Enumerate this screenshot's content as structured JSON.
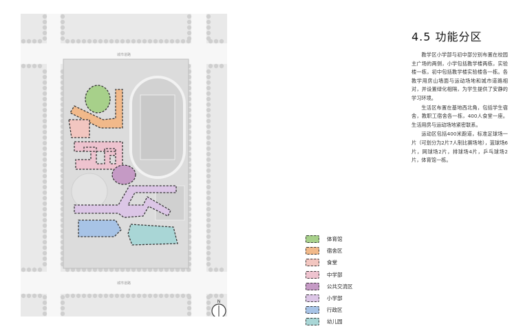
{
  "title": "4.5 功能分区",
  "paragraphs": [
    "教学区小学部与初中部分别布置在校园主广场的两侧，小学包括教学楼两栋，实验楼一栋，初中包括教学楼实验楼各一栋。各教学用房山墙面与运动场地和城市道路相对，并设置绿化相隔，为学生提供了安静的学习环境。",
    "生活区布置在基地西北角，包括学生宿舍，教职工宿舍各一栋，400人食堂一座。生活用房与运动场地紧密联系。",
    "运动区包括400米跑道，标准足球场一片（可划分为2片7人制比赛场地），篮球场6片，网球场2片，排球场4片，乒乓球场2片，体育馆一栋。"
  ],
  "legend": [
    {
      "label": "体育馆",
      "color": "#a7d08a"
    },
    {
      "label": "宿舍区",
      "color": "#f1b98a"
    },
    {
      "label": "食堂",
      "color": "#f2c6c0"
    },
    {
      "label": "中学部",
      "color": "#eec3cf"
    },
    {
      "label": "公共交流区",
      "color": "#c59ac5"
    },
    {
      "label": "小学部",
      "color": "#dcc6e6"
    },
    {
      "label": "行政区",
      "color": "#a7c3e6"
    },
    {
      "label": "幼儿园",
      "color": "#a9d6d6"
    }
  ],
  "plan": {
    "road_label_top": "城市道路",
    "road_label_bottom": "城市道路",
    "north_mark": "N"
  }
}
